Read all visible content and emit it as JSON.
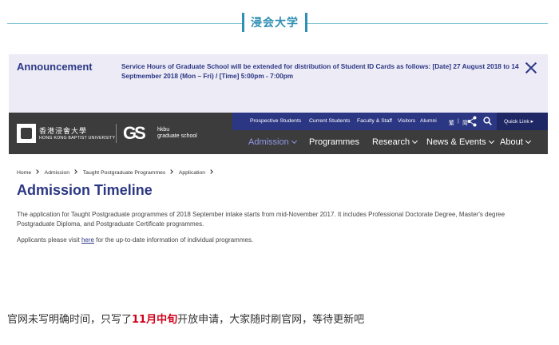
{
  "article": {
    "header_title": "浸会大学",
    "caption_before": "官网未写明确时间，只写了",
    "caption_highlight": "11月中旬",
    "caption_after": "开放申请，大家随时刷官网，等待更新吧"
  },
  "announcement": {
    "title": "Announcement",
    "text": "Service Hours of Graduate School will be extended for distribution of Student ID Cards as follows: [Date] 27 August 2018 to 14 Septmember 2018 (Mon – Fri) / [Time] 5:00pm - 7:00pm",
    "close_icon": "close-icon"
  },
  "header": {
    "logo_cn": "香港浸會大學",
    "logo_en": "HONG KONG BAPTIST UNIVERSITY",
    "gs_mark": "GS",
    "gs_line1": "hkbu",
    "gs_line2": "graduate school",
    "top_links": [
      "Prospective Students",
      "Current Students",
      "Faculty & Staff",
      "Visitors",
      "Alumni"
    ],
    "lang_trad": "繁",
    "lang_simp": "简",
    "quick_link": "Quick Link ▸",
    "main_nav": [
      "Admission",
      "Programmes",
      "Research",
      "News & Events",
      "About"
    ]
  },
  "content": {
    "breadcrumb": [
      "Home",
      "Admission",
      "Taught Postgraduate Programmes",
      "Application"
    ],
    "title": "Admission Timeline",
    "para1": "The application for Taught Postgraduate programmes of 2018 September intake starts from mid-November 2017.  It includes Professional Doctorate Degree, Master's degree Postgraduate Diploma, and Postgraduate Certificate programmes.",
    "para2_before": "Applicants please visit ",
    "para2_link": "here",
    "para2_after": " for the up-to-date information of individual programmes."
  },
  "colors": {
    "brand_navy": "#2c3784",
    "nav_dark": "#3c3c3c",
    "accent_teal": "#2f8fb4",
    "highlight_red": "#d0021b"
  }
}
